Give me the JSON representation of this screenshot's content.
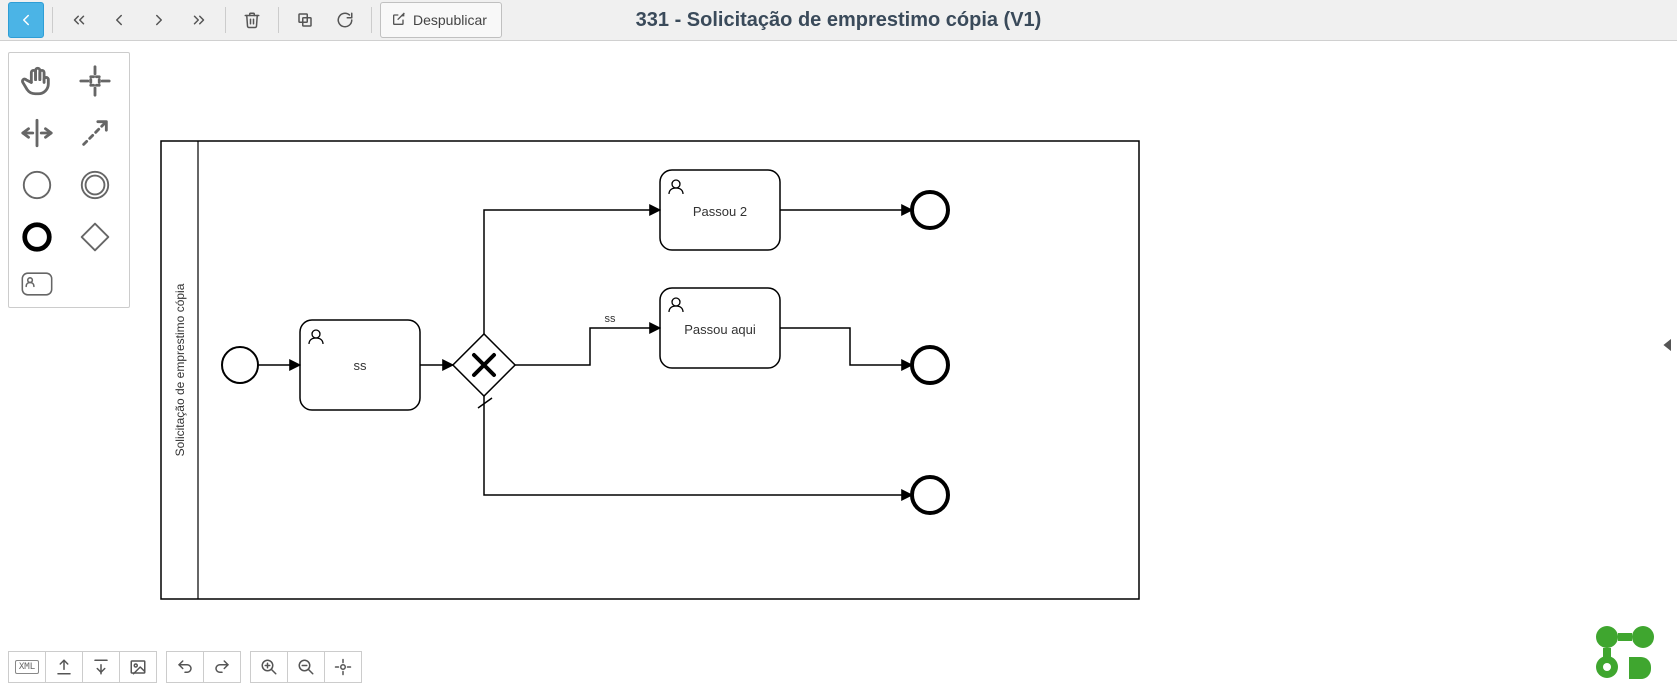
{
  "header": {
    "title": "331 - Solicitação de emprestimo cópia (V1)",
    "unpublish_label": "Despublicar"
  },
  "toolbar": {
    "back": "back-button",
    "first": "first-button",
    "prev": "prev-button",
    "next": "next-button",
    "last": "last-button",
    "delete": "delete-button",
    "copy": "copy-button",
    "refresh": "refresh-button"
  },
  "palette": {
    "hand": "hand-tool",
    "lasso": "lasso-tool",
    "space": "space-tool",
    "connect": "connect-tool",
    "start_event": "start-event",
    "intermediate_event": "intermediate-event",
    "end_event": "end-event",
    "gateway": "gateway",
    "user_task": "user-task"
  },
  "diagram": {
    "pool_label": "Solicitação de emprestimo cópia",
    "tasks": {
      "t1": "ss",
      "t2": "Passou 2",
      "t3": "Passou aqui"
    },
    "edge_labels": {
      "e_ss": "ss"
    }
  },
  "bottombar": {
    "xml": "XML"
  }
}
